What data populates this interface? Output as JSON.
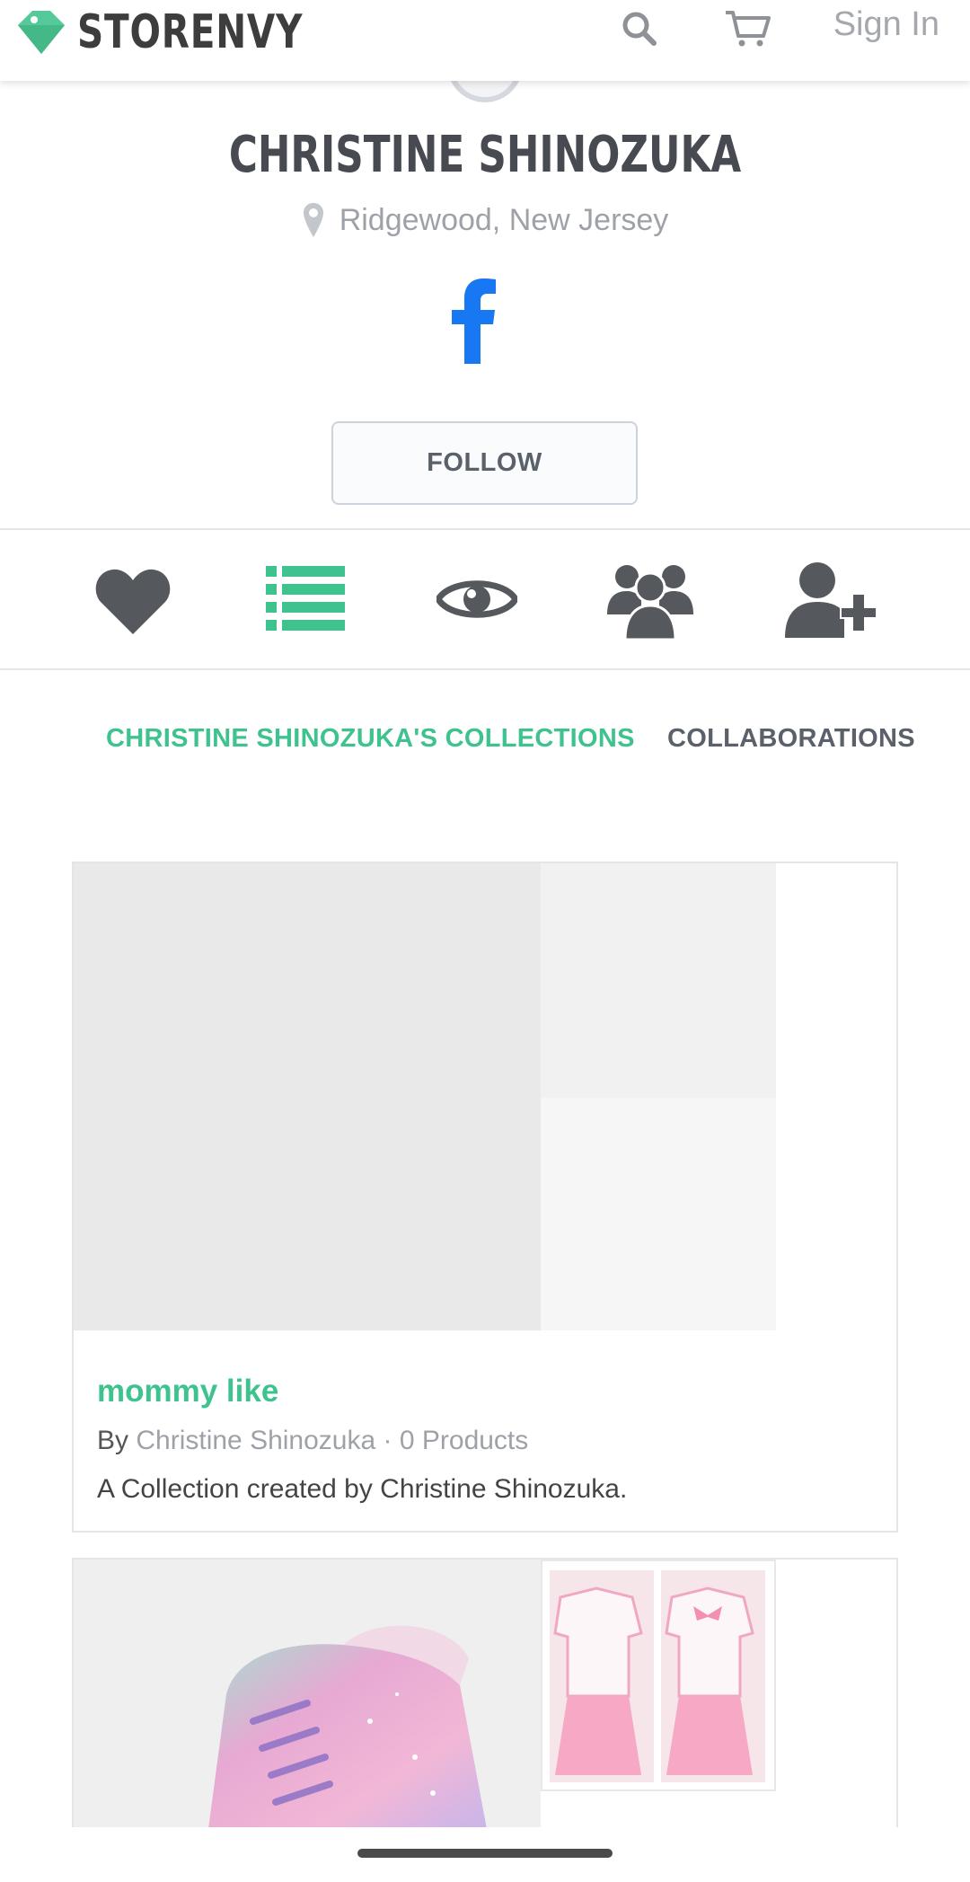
{
  "header": {
    "brand": "STORENVY",
    "signin_label": "Sign In"
  },
  "profile": {
    "name": "CHRISTINE SHINOZUKA",
    "location": "Ridgewood, New Jersey",
    "follow_label": "FOLLOW"
  },
  "icon_tabs": [
    {
      "icon": "heart-icon",
      "active": false
    },
    {
      "icon": "list-icon",
      "active": true
    },
    {
      "icon": "eye-icon",
      "active": false
    },
    {
      "icon": "users-icon",
      "active": false
    },
    {
      "icon": "user-plus-icon",
      "active": false
    }
  ],
  "sub_tabs": {
    "collections": "CHRISTINE SHINOZUKA'S COLLECTIONS",
    "collaborations": "COLLABORATIONS"
  },
  "collections": [
    {
      "title": "mommy like",
      "by_prefix": "By",
      "author": "Christine Shinozuka",
      "separator": "·",
      "products": "0 Products",
      "description": "A Collection created by Christine Shinozuka."
    }
  ],
  "colors": {
    "accent": "#3fc38e",
    "facebook": "#1877f2",
    "icon_gray": "#55585c"
  }
}
